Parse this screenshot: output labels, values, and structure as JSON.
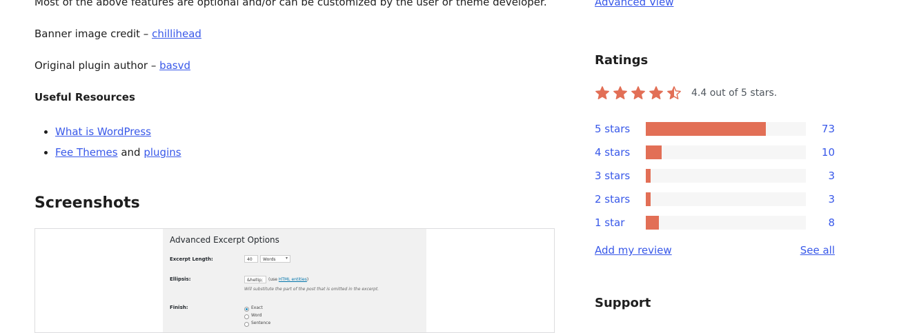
{
  "description": {
    "features_note": "Most of the above features are optional and/or can be customized by the user or theme developer.",
    "banner_credit_prefix": "Banner image credit – ",
    "banner_credit_link": "chillihead",
    "author_prefix": "Original plugin author – ",
    "author_link": "basvd",
    "useful_resources_heading": "Useful Resources",
    "resources": [
      {
        "link": "What is WordPress"
      },
      {
        "link1": "Fee Themes",
        "joiner": " and ",
        "link2": "plugins"
      }
    ]
  },
  "screenshots": {
    "heading": "Screenshots",
    "image": {
      "title": "Advanced Excerpt Options",
      "excerpt_length_label": "Excerpt Length:",
      "excerpt_length_value": "40",
      "excerpt_length_unit": "Words",
      "ellipsis_label": "Ellipsis:",
      "ellipsis_value": "&hellip;",
      "ellipsis_hint_prefix": "(use ",
      "ellipsis_hint_link": "HTML entities",
      "ellipsis_hint_suffix": ")",
      "ellipsis_note": "Will substitute the part of the post that is omitted in the excerpt.",
      "finish_label": "Finish:",
      "finish_options": [
        "Exact",
        "Word",
        "Sentence"
      ]
    }
  },
  "sidebar": {
    "advanced_view_link": "Advanced View",
    "ratings": {
      "heading": "Ratings",
      "average": 4.4,
      "max": 5,
      "summary": "4.4 out of 5 stars.",
      "colors": {
        "star": "#e26f56",
        "bar_fill": "#e26f56",
        "bar_track": "#f6f6f6"
      },
      "breakdown": [
        {
          "label": "5 stars",
          "count": "73",
          "fraction": 0.75
        },
        {
          "label": "4 stars",
          "count": "10",
          "fraction": 0.1
        },
        {
          "label": "3 stars",
          "count": "3",
          "fraction": 0.03
        },
        {
          "label": "2 stars",
          "count": "3",
          "fraction": 0.03
        },
        {
          "label": "1 star",
          "count": "8",
          "fraction": 0.08
        }
      ],
      "add_review_link": "Add my review",
      "see_all_link": "See all"
    },
    "support_heading": "Support"
  },
  "colors": {
    "link": "#3858e9",
    "text": "#1e1e1e"
  }
}
